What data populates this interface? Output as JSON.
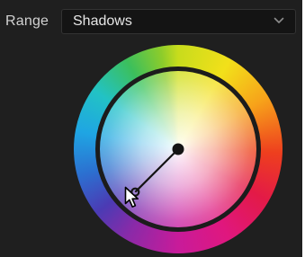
{
  "range_control": {
    "label": "Range",
    "selected_value": "Shadows"
  },
  "icons": {
    "dropdown": "chevron-down-icon",
    "pointer": "mouse-pointer-icon"
  },
  "color_wheel": {
    "puck_direction_deg": 225,
    "puck_offset_fraction": 0.75
  },
  "colors": {
    "panel_background": "#1f1f1f",
    "dropdown_background": "#141414",
    "label_text": "#d2d2d2",
    "ring_outline": "#1c1c1c"
  }
}
